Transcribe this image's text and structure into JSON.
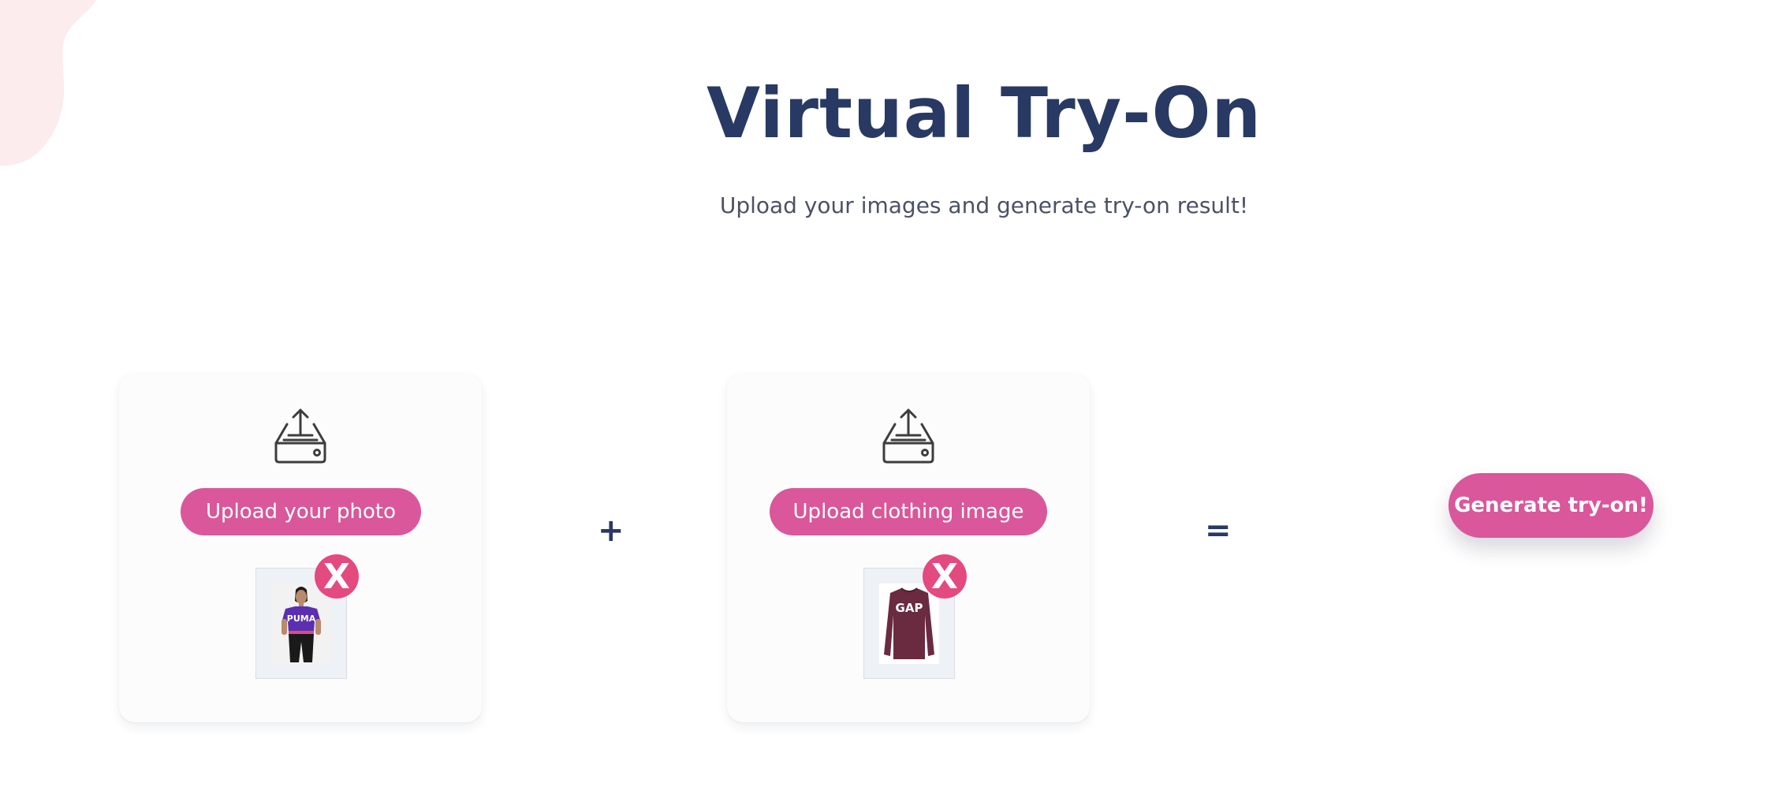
{
  "header": {
    "title": "Virtual Try-On",
    "subtitle": "Upload your images and generate try-on result!"
  },
  "person_card": {
    "upload_label": "Upload your photo",
    "remove_label": "X",
    "thumbnail": "person-photo"
  },
  "operators": {
    "plus": "+",
    "equals": "="
  },
  "clothing_card": {
    "upload_label": "Upload clothing image",
    "remove_label": "X",
    "thumbnail": "clothing-photo"
  },
  "actions": {
    "generate_label": "Generate try-on!"
  },
  "colors": {
    "title": "#283a63",
    "subtitle": "#4a5263",
    "accent": "#d9579a",
    "remove": "#e4497f",
    "blob": "#fcecee",
    "card_bg": "#fcfcfd"
  },
  "icons": [
    "upload-tray-icon",
    "close-icon"
  ]
}
